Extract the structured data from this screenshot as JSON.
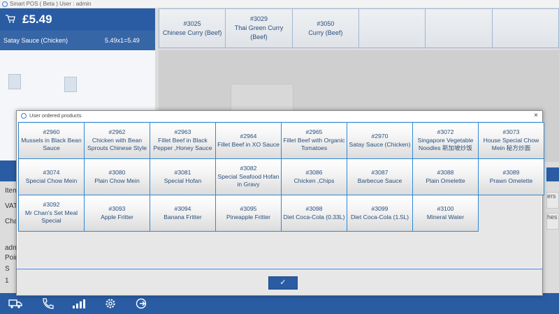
{
  "window": {
    "title": "Smart POS ( Beta )  User : admin"
  },
  "order": {
    "total": "£5.49",
    "line": {
      "name": "Satay Sauce (Chicken)",
      "price_qty": "5.49x1=5.49"
    }
  },
  "top_products": [
    {
      "number": "#3025",
      "name": "Chinese Curry (Beef)"
    },
    {
      "number": "#3029",
      "name": "Thai Green Curry (Beef)"
    },
    {
      "number": "#3050",
      "name": "Curry (Beef)"
    },
    {
      "number": "",
      "name": ""
    },
    {
      "number": "",
      "name": ""
    },
    {
      "number": "",
      "name": ""
    }
  ],
  "left_info": [
    "Item",
    "VAT",
    "Char",
    "adm",
    "Poin",
    "S",
    "1"
  ],
  "right_partial": [
    "ers",
    "hes"
  ],
  "dialog": {
    "title": "User ordered products",
    "close_glyph": "×",
    "ok_glyph": "✓",
    "products": [
      {
        "number": "#2960",
        "name": "Mussels in Black Bean Sauce"
      },
      {
        "number": "#2962",
        "name": "Chicken with Bean Sprouts Chinese Style"
      },
      {
        "number": "#2963",
        "name": "Fillet Beef in Black Pepper ,Honey Sauce"
      },
      {
        "number": "#2964",
        "name": "Fillet Beef in XO Sauce"
      },
      {
        "number": "#2965",
        "name": "Fillet Beef with Organic Tomatoes"
      },
      {
        "number": "#2970",
        "name": "Satay Sauce (Chicken)"
      },
      {
        "number": "#3072",
        "name": "Singapore Vegetable Noodles 新加坡炒饭"
      },
      {
        "number": "#3073",
        "name": "House Special Chow Mein 秘方炒面"
      },
      {
        "number": "#3074",
        "name": "Special Chow Mein"
      },
      {
        "number": "#3080",
        "name": "Plain Chow Mein"
      },
      {
        "number": "#3081",
        "name": "Special Hofan"
      },
      {
        "number": "#3082",
        "name": "Special Seafood Hofan in Gravy"
      },
      {
        "number": "#3086",
        "name": "Chicken ,Chips"
      },
      {
        "number": "#3087",
        "name": "Barbecue Sauce"
      },
      {
        "number": "#3088",
        "name": "Plain Omelette"
      },
      {
        "number": "#3089",
        "name": "Prawn Omelette"
      },
      {
        "number": "#3092",
        "name": "Mr Chan's Set Meal Special"
      },
      {
        "number": "#3093",
        "name": "Apple Fritter"
      },
      {
        "number": "#3094",
        "name": "Banana Fritter"
      },
      {
        "number": "#3095",
        "name": "Pineapple Fritter"
      },
      {
        "number": "#3098",
        "name": "Diet Coca-Cola (0.33L)"
      },
      {
        "number": "#3099",
        "name": "Diet Coca-Cola (1.5L)"
      },
      {
        "number": "#3100",
        "name": "Mineral Water"
      }
    ]
  },
  "toolbar_icons": [
    "delivery-truck-icon",
    "phone-icon",
    "chart-icon",
    "gear-icon",
    "logout-icon"
  ],
  "colors": {
    "accent": "#2a5ca3",
    "tile_border": "#2e88d6",
    "text": "#2a4f7c"
  }
}
